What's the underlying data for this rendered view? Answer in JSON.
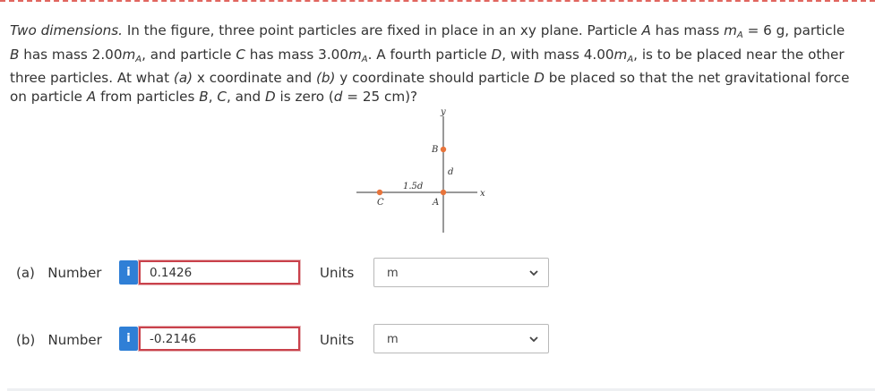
{
  "question": {
    "title": "Two dimensions.",
    "text_1": " In the figure, three point particles are fixed in place in an xy plane. Particle ",
    "A": "A",
    "text_2": " has mass ",
    "m": "m",
    "sub_A": "A",
    "text_3": " = 6 g, particle ",
    "B": "B",
    "text_4": " has mass 2.00",
    "text_5": ", and particle ",
    "C": "C",
    "text_6": " has mass 3.00",
    "text_7": ". A fourth particle ",
    "D": "D",
    "text_8": ", with mass 4.00",
    "text_9": ", is to be placed near the other three particles. At what ",
    "part_a": "(a)",
    "text_10": " x coordinate and ",
    "part_b": "(b)",
    "text_11": " y coordinate should particle ",
    "text_12": " be placed so that the net gravitational force on particle ",
    "text_13": " from particles ",
    "text_14": ", ",
    "text_15": ", and ",
    "text_16": " is zero (",
    "d": "d",
    "text_17": " = 25 cm)?"
  },
  "figure": {
    "y_axis_label": "y",
    "x_axis_label": "x",
    "label_B": "B",
    "label_A": "A",
    "label_C": "C",
    "label_d": "d",
    "label_15d": "1.5d",
    "particle_color": "#e8743b"
  },
  "answers": [
    {
      "part": "(a)",
      "label": "Number",
      "info": "i",
      "value": "0.1426",
      "units_label": "Units",
      "units_value": "m"
    },
    {
      "part": "(b)",
      "label": "Number",
      "info": "i",
      "value": "-0.2146",
      "units_label": "Units",
      "units_value": "m"
    }
  ]
}
